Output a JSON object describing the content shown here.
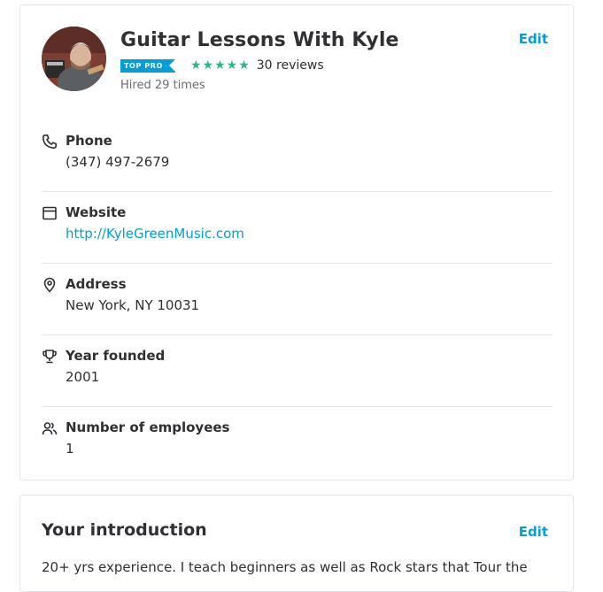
{
  "profile": {
    "business_name": "Guitar Lessons With Kyle",
    "badge": "TOP PRO",
    "rating_stars": 5,
    "reviews": "30 reviews",
    "hired": "Hired 29 times",
    "edit_label": "Edit",
    "avatar_icon": "profile-photo",
    "star_color": "#2db783",
    "accent_color": "#009fd9"
  },
  "details": [
    {
      "icon": "phone-icon",
      "label": "Phone",
      "value": "(347) 497-2679"
    },
    {
      "icon": "browser-window-icon",
      "label": "Website",
      "value": "http://KyleGreenMusic.com"
    },
    {
      "icon": "map-pin-icon",
      "label": "Address",
      "value": "New York, NY 10031"
    },
    {
      "icon": "trophy-icon",
      "label": "Year founded",
      "value": "2001"
    },
    {
      "icon": "people-icon",
      "label": "Number of employees",
      "value": "1"
    }
  ],
  "introduction": {
    "title": "Your introduction",
    "edit_label": "Edit",
    "text": "20+ yrs experience. I teach beginners as well as Rock stars that Tour the"
  }
}
